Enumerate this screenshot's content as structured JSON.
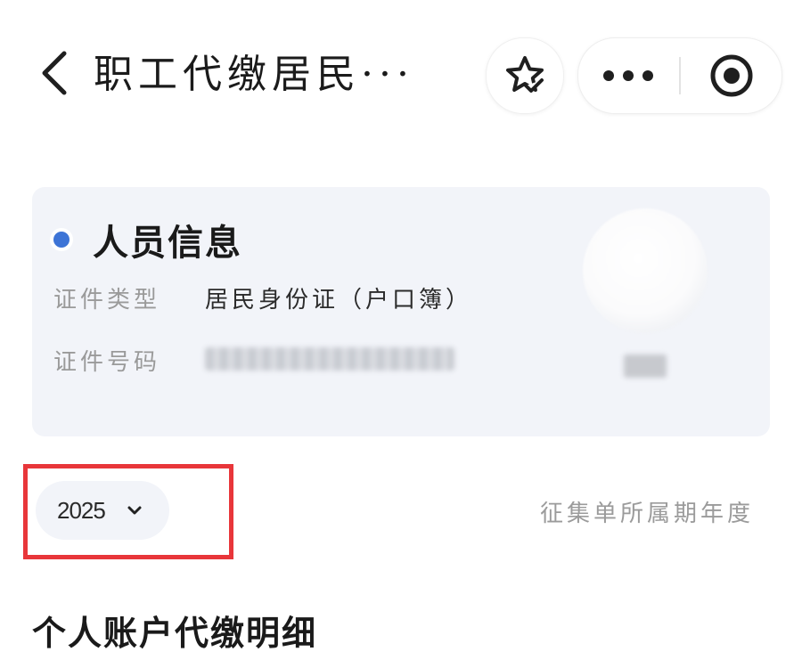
{
  "nav": {
    "title": "职工代缴居民···"
  },
  "icons": {
    "back": "chevron-left-icon",
    "favorite": "star-check-icon",
    "more": "more-dots-icon",
    "close": "target-circle-icon",
    "year_dropdown": "chevron-down-icon"
  },
  "person_info": {
    "title": "人员信息",
    "fields": [
      {
        "label": "证件类型",
        "value": "居民身份证（户口簿）"
      },
      {
        "label": "证件号码",
        "value": ""
      }
    ]
  },
  "year_selector": {
    "value": "2025",
    "note": "征集单所属期年度"
  },
  "section": {
    "title": "个人账户代缴明细"
  },
  "colors": {
    "accent_blue": "#3d74d6",
    "card_background": "#f2f4f9",
    "highlight_red": "#e8363a",
    "muted_text": "#9b9b9b"
  }
}
